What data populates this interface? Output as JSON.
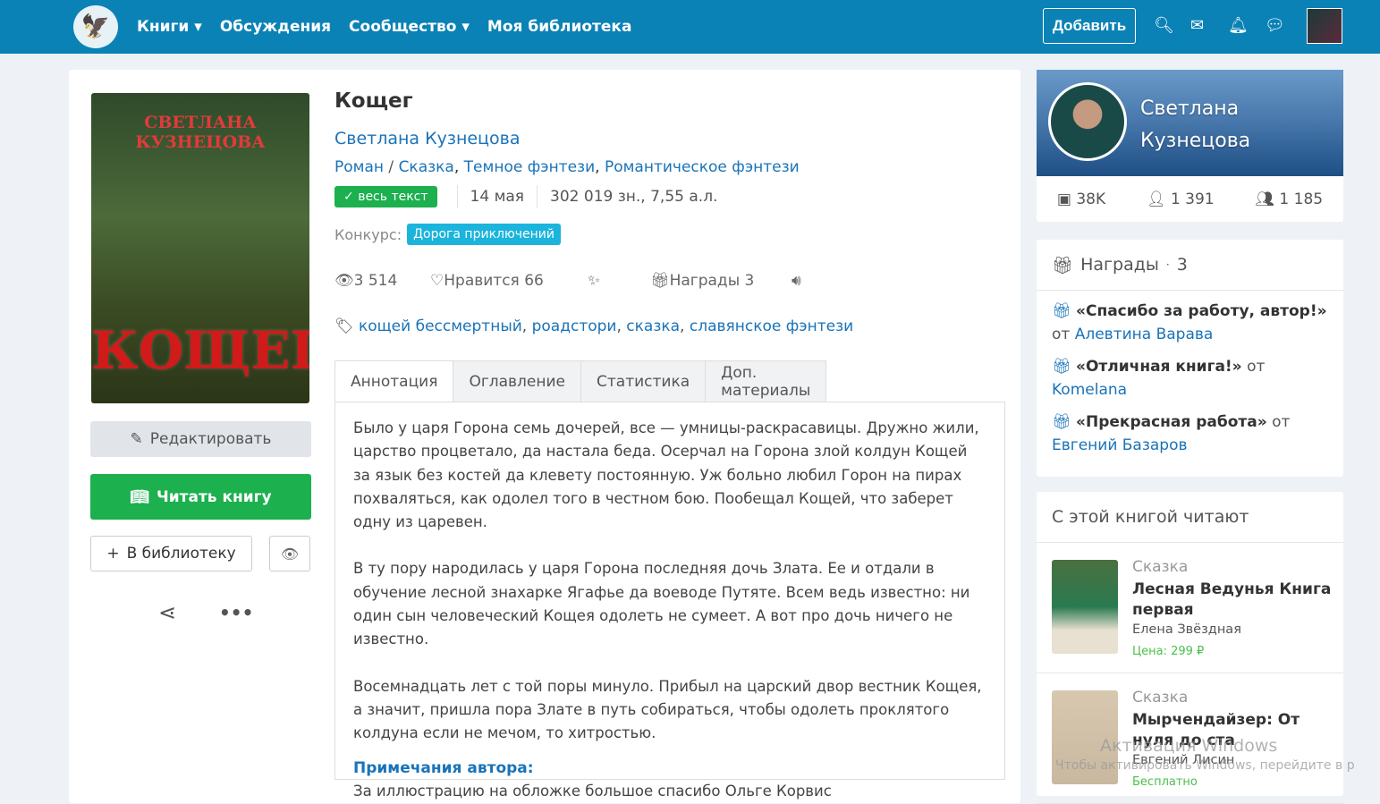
{
  "nav": {
    "menu": [
      "Книги ▾",
      "Обсуждения",
      "Сообщество ▾",
      "Моя библиотека"
    ],
    "add": "Добавить"
  },
  "cover": {
    "author": "СВЕТЛАНА КУЗНЕЦОВА",
    "title": "КОЩЕГ"
  },
  "actions": {
    "edit": "Редактировать",
    "read": "Читать книгу",
    "library": "В библиотеку"
  },
  "book": {
    "title": "Кощег",
    "author": "Светлана Кузнецова",
    "genres": [
      "Роман",
      "Сказка",
      "Темное фэнтези",
      "Романтическое фэнтези"
    ],
    "status": "весь текст",
    "date": "14 мая",
    "size": "302 019 зн., 7,55 а.л.",
    "contest_label": "Конкурс:",
    "contest": "Дорога приключений",
    "views": "3 514",
    "likes": "Нравится  66",
    "awards": "Награды 3",
    "tags": [
      "кощей бессмертный",
      "роадстори",
      "сказка",
      "славянское фэнтези"
    ]
  },
  "tabs": [
    "Аннотация",
    "Оглавление",
    "Статистика",
    "Доп. материалы"
  ],
  "annotation": {
    "p1": "Было у царя Горона семь дочерей, все — умницы-раскрасавицы. Дружно жили, царство процветало, да настала беда. Осерчал на Горона злой колдун Кощей за язык без костей да клевету постоянную. Уж больно любил Горон на пирах похваляться, как одолел того в честном бою. Пообещал Кощей, что заберет одну из царевен.",
    "p2": "В ту пору народилась у царя Горона последняя дочь Злата. Ее и отдали в обучение лесной знахарке Ягафье да воеводе Путяте. Всем ведь известно: ни один сын человеческий Кощея одолеть не сумеет. А вот про дочь ничего не известно.",
    "p3": "Восемнадцать лет с той поры минуло. Прибыл на царский двор вестник Кощея, а значит, пришла пора Злате в путь собираться, чтобы одолеть проклятого колдуна если не мечом, то хитростью.",
    "notes_title": "Примечания автора:",
    "notes": "За иллюстрацию на обложке большое спасибо Ольге Корвис"
  },
  "profile": {
    "name1": "Светлана",
    "name2": "Кузнецова",
    "stats": [
      "38K",
      "1 391",
      "1 185"
    ]
  },
  "awards": {
    "title": "Награды",
    "count": "3",
    "items": [
      {
        "name": "«Спасибо за работу, автор!»",
        "from": "от",
        "by": "Алевтина Варава"
      },
      {
        "name": "«Отличная книга!»",
        "from": "от",
        "by": "Komelana"
      },
      {
        "name": "«Прекрасная работа»",
        "from": "от",
        "by": "Евгений Базаров"
      }
    ]
  },
  "reading": {
    "title": "С этой книгой читают",
    "items": [
      {
        "genre": "Сказка",
        "name": "Лесная Ведунья Книга первая",
        "author": "Елена Звёздная",
        "price": "Цена: 299 ₽"
      },
      {
        "genre": "Сказка",
        "name": "Мырчендайзер: От нуля до ста",
        "author": "Евгений Лисин",
        "price": "Бесплатно"
      }
    ]
  },
  "watermark": {
    "l1": "Активация Windows",
    "l2": "Чтобы активировать Windows, перейдите в р"
  }
}
